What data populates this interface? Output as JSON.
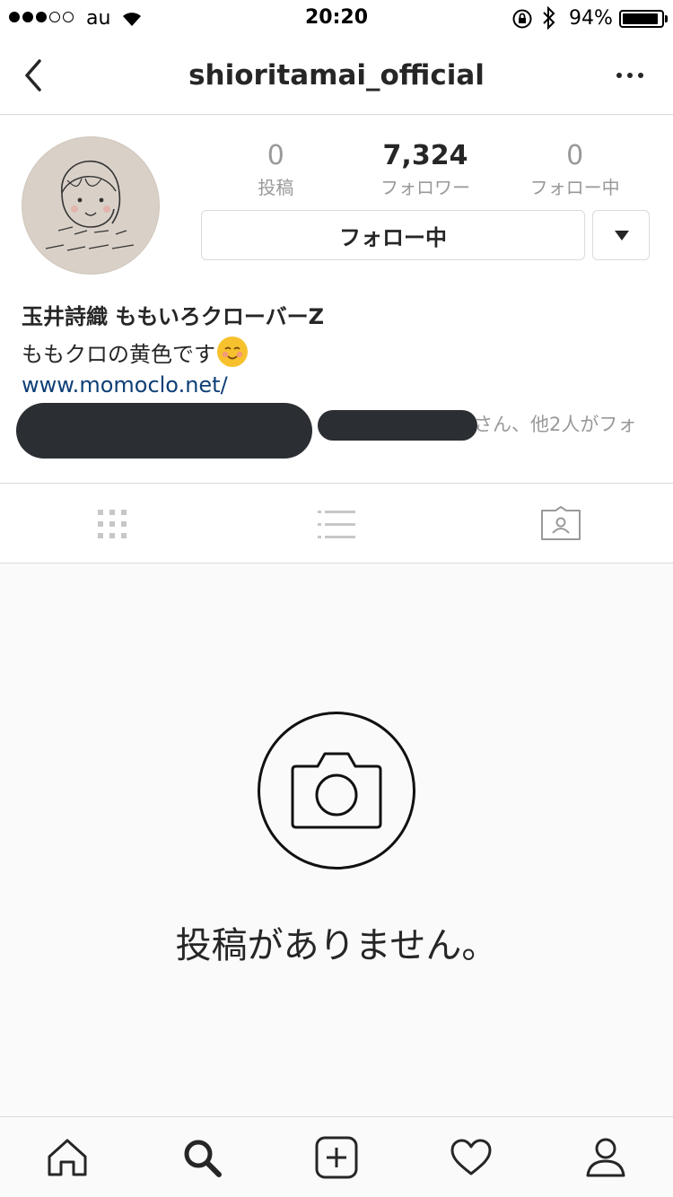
{
  "status_bar": {
    "carrier": "au",
    "time": "20:20",
    "battery_pct": "94%",
    "battery_level": 0.94,
    "signal_bars_filled": 3,
    "signal_bars_total": 5
  },
  "header": {
    "title": "shioritamai_official",
    "back_icon": "chevron-left-icon",
    "more_icon": "more-horizontal-icon"
  },
  "profile": {
    "stats": [
      {
        "value": "0",
        "label": "投稿"
      },
      {
        "value": "7,324",
        "label": "フォロワー"
      },
      {
        "value": "0",
        "label": "フォロー中"
      }
    ],
    "follow_button_label": "フォロー中",
    "name": "玉井詩織 ももいろクローバーZ",
    "bio": "ももクロの黄色です",
    "website": "www.momoclo.net/",
    "followed_by": "さん、他2人がフォ"
  },
  "view_tabs": [
    {
      "name": "grid-view-icon",
      "active": false
    },
    {
      "name": "list-view-icon",
      "active": false
    },
    {
      "name": "tagged-photos-icon",
      "active": false
    }
  ],
  "empty_state": {
    "icon": "camera-icon",
    "message": "投稿がありません。"
  },
  "tab_bar": [
    {
      "name": "home-icon"
    },
    {
      "name": "search-icon"
    },
    {
      "name": "add-post-icon"
    },
    {
      "name": "activity-heart-icon"
    },
    {
      "name": "profile-icon"
    }
  ],
  "colors": {
    "text": "#262626",
    "secondary": "#999999",
    "link": "#0e3f76",
    "border": "#dbdbdb",
    "avatar_bg": "#d9d1c8"
  }
}
